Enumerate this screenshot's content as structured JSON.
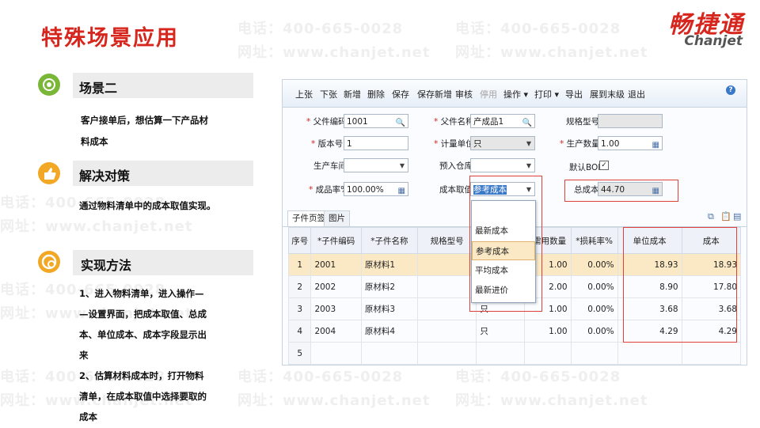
{
  "watermark": {
    "phone": "电话：400-665-0028",
    "site": "网址：www.chanjet.net"
  },
  "slide_title": "特殊场景应用",
  "logo": {
    "cn": "畅捷通",
    "en": "Chanjet"
  },
  "sections": {
    "scenario": {
      "title": "场景二",
      "text_lines": [
        "客户接单后，想估算一下产品材",
        "料成本"
      ]
    },
    "solution": {
      "title": "解决对策",
      "text_lines": [
        "通过物料清单中的成本取值实现。"
      ]
    },
    "method": {
      "title": "实现方法",
      "text_lines": [
        "1、进入物料清单，进入操作—",
        "—设置界面，把成本取值、总成",
        "本、单位成本、成本字段显示出",
        "来",
        "2、估算材料成本时，打开物料",
        "清单，在成本取值中选择要取的",
        "成本"
      ]
    }
  },
  "app": {
    "toolbar": {
      "buttons": [
        "上张",
        "下张",
        "新增",
        "删除",
        "保存",
        "保存新增",
        "审核",
        "停用",
        "操作 ▾",
        "打印 ▾",
        "导出",
        "展到末级",
        "退出"
      ],
      "help": "?"
    },
    "form": {
      "parent_code_label": "父件编码",
      "parent_code": "1001",
      "parent_name_label": "父件名称",
      "parent_name": "产成品1",
      "spec_label": "规格型号",
      "spec": "",
      "version_label": "版本号",
      "version": "1",
      "unit_label": "计量单位",
      "unit": "只",
      "qty_label": "生产数量",
      "qty": "1.00",
      "workshop_label": "生产车间",
      "workshop": "",
      "warehouse_label": "预入仓库",
      "warehouse": "",
      "bom_label": "默认BOM",
      "bom_checked": "✓",
      "yield_label": "成品率%",
      "yield": "100.00%",
      "cost_source_label": "成本取值",
      "cost_source": "参考成本",
      "total_cost_label": "总成本",
      "total_cost": "44.70"
    },
    "dropdown_options": [
      "最新成本",
      "参考成本",
      "平均成本",
      "最新进价"
    ],
    "tabs": [
      "子件页签",
      "图片"
    ],
    "grid": {
      "columns": [
        "序号",
        "*子件编码",
        "*子件名称",
        "规格型号",
        "计",
        "*需用数量",
        "*损耗率%",
        "单位成本",
        "成本"
      ],
      "rows": [
        [
          "1",
          "2001",
          "原材料1",
          "",
          "",
          "1.00",
          "0.00%",
          "18.93",
          "18.93"
        ],
        [
          "2",
          "2002",
          "原材料2",
          "",
          "",
          "2.00",
          "0.00%",
          "8.90",
          "17.80"
        ],
        [
          "3",
          "2003",
          "原材料3",
          "",
          "只",
          "1.00",
          "0.00%",
          "3.68",
          "3.68"
        ],
        [
          "4",
          "2004",
          "原材料4",
          "",
          "只",
          "1.00",
          "0.00%",
          "4.29",
          "4.29"
        ],
        [
          "5",
          "",
          "",
          "",
          "",
          "",
          "",
          "",
          ""
        ]
      ]
    }
  },
  "colors": {
    "brand_red": "#d6261d",
    "highlight": "#fbe8c4",
    "annot_red": "#e0403a"
  }
}
